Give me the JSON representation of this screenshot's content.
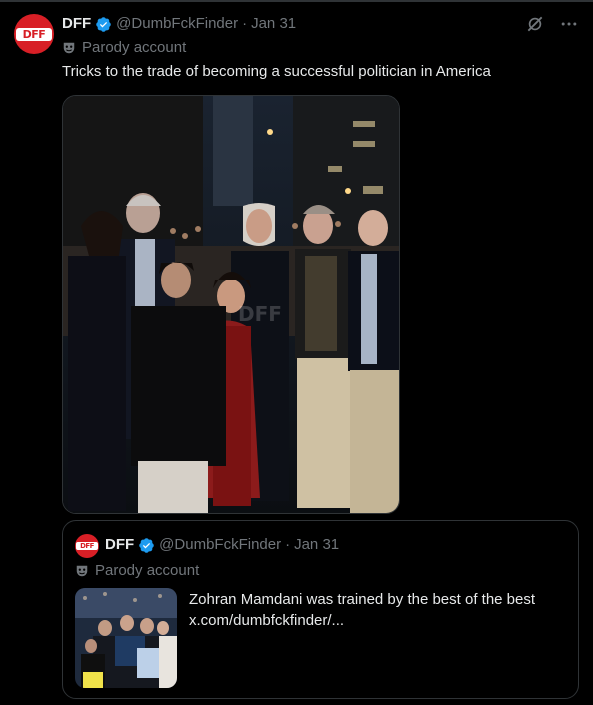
{
  "post": {
    "author_name": "DFF",
    "handle": "@DumbFckFinder",
    "separator": "·",
    "date": "Jan 31",
    "account_label": "Parody account",
    "text": "Tricks to the trade of becoming a successful politician in America",
    "avatar_text": "DFF",
    "photo_watermark": "DFF"
  },
  "quoted": {
    "author_name": "DFF",
    "handle": "@DumbFckFinder",
    "separator": "·",
    "date": "Jan 31",
    "account_label": "Parody account",
    "text_line1": "Zohran Mamdani was trained by the best of the best",
    "link": "x.com/dumbfckfinder/..."
  },
  "colors": {
    "background": "#000000",
    "text": "#e7e9ea",
    "muted": "#71767b",
    "verified": "#1d9bf0",
    "border": "#2f3336",
    "avatar": "#d81f26"
  },
  "icons": [
    "verified-badge-icon",
    "parody-mask-icon",
    "grok-icon",
    "more-icon"
  ]
}
